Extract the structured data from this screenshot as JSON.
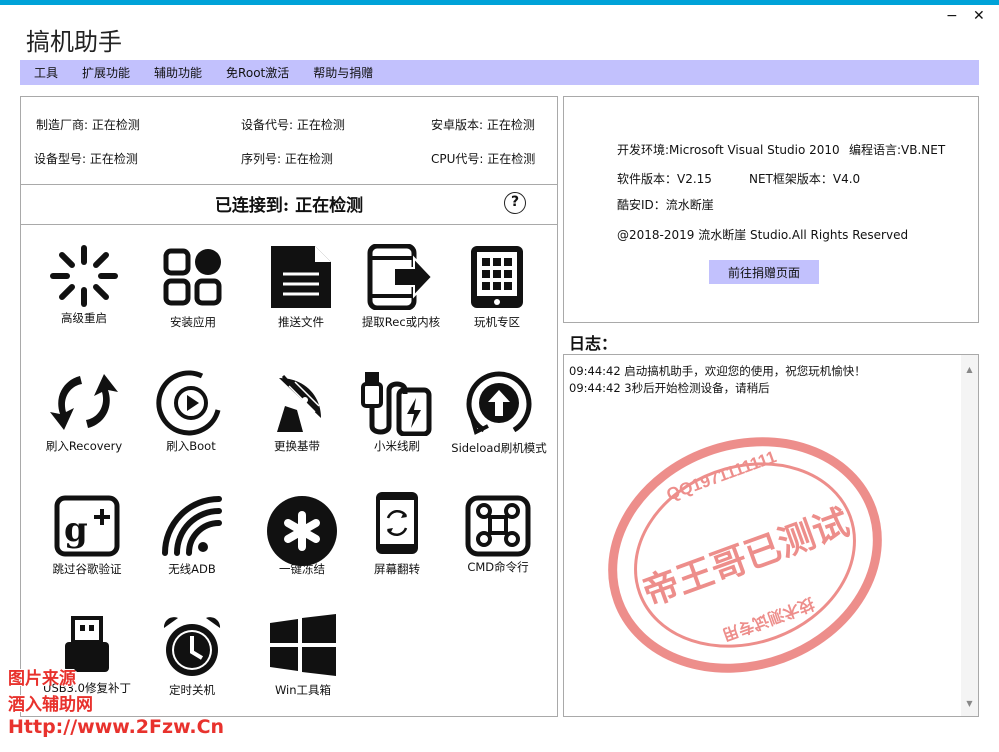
{
  "app": {
    "title": "搞机助手",
    "minimize": "−",
    "close": "✕"
  },
  "menu": [
    "工具",
    "扩展功能",
    "辅助功能",
    "免Root激活",
    "帮助与捐赠"
  ],
  "device": {
    "manufacturer": "制造厂商: 正在检测",
    "codename": "设备代号: 正在检测",
    "android_version": "安卓版本: 正在检测",
    "model": "设备型号: 正在检测",
    "serial": "序列号: 正在检测",
    "cpu": "CPU代号: 正在检测"
  },
  "connection": {
    "status": "已连接到: 正在检测",
    "help": "?"
  },
  "tools": [
    {
      "label": "高级重启",
      "icon": "spinner-icon"
    },
    {
      "label": "安装应用",
      "icon": "apps-grid-icon"
    },
    {
      "label": "推送文件",
      "icon": "document-icon"
    },
    {
      "label": "提取Rec或内核",
      "icon": "phone-export-icon"
    },
    {
      "label": "玩机专区",
      "icon": "tablet-icon"
    },
    {
      "label": "刷入Recovery",
      "icon": "sync-arrows-icon"
    },
    {
      "label": "刷入Boot",
      "icon": "play-circle-icon"
    },
    {
      "label": "更换基带",
      "icon": "satellite-dish-icon"
    },
    {
      "label": "小米线刷",
      "icon": "charging-cable-icon"
    },
    {
      "label": "Sideload刷机模式",
      "icon": "upload-circle-icon"
    },
    {
      "label": "跳过谷歌验证",
      "icon": "google-plus-icon"
    },
    {
      "label": "无线ADB",
      "icon": "wifi-icon"
    },
    {
      "label": "一键冻结",
      "icon": "asterisk-icon"
    },
    {
      "label": "屏幕翻转",
      "icon": "screen-rotate-icon"
    },
    {
      "label": "CMD命令行",
      "icon": "command-icon"
    },
    {
      "label": "USB3.0修复补丁",
      "icon": "usb-icon"
    },
    {
      "label": "定时关机",
      "icon": "alarm-clock-icon"
    },
    {
      "label": "Win工具箱",
      "icon": "windows-icon"
    }
  ],
  "about": {
    "dev_env": "开发环境:Microsoft Visual Studio 2010",
    "language": "编程语言:VB.NET",
    "version": "软件版本：V2.15",
    "net_version": "NET框架版本：V4.0",
    "coolapk": "酷安ID：流水断崖",
    "copyright": "@2018-2019  流水断崖 Studio.All Rights Reserved",
    "donate_button": "前往捐赠页面"
  },
  "log": {
    "title": "日志：",
    "lines": [
      "09:44:42 启动搞机助手，欢迎您的使用，祝您玩机愉快！",
      "09:44:42 3秒后开始检测设备，请稍后"
    ]
  },
  "stamp": {
    "main": "帝王哥已测试",
    "ring": "QQ1971111111",
    "bottom": "技术测试专用"
  },
  "watermark": {
    "line1": "图片来源",
    "line2": "酒入辅助网",
    "line3": "Http://www.2Fzw.Cn"
  },
  "colors": {
    "accent": "#00a2d8",
    "menu_bg": "#c2c1fd",
    "stamp": "#e0322e"
  }
}
